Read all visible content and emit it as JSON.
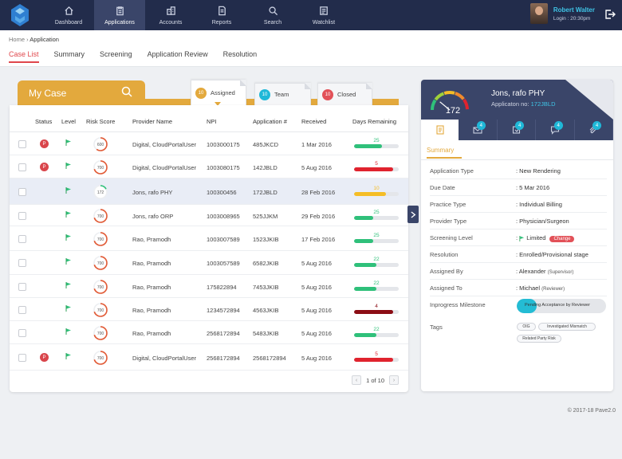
{
  "nav": {
    "items": [
      {
        "label": "Dashboard",
        "icon": "home-icon"
      },
      {
        "label": "Applications",
        "icon": "clipboard-icon"
      },
      {
        "label": "Accounts",
        "icon": "building-icon"
      },
      {
        "label": "Reports",
        "icon": "report-icon"
      },
      {
        "label": "Search",
        "icon": "search-icon"
      },
      {
        "label": "Watchlist",
        "icon": "watchlist-icon"
      }
    ],
    "active": "Applications"
  },
  "user": {
    "name": "Robert Walter",
    "login": "Login : 20:30pm"
  },
  "breadcrumb": {
    "home": "Home",
    "sep": "›",
    "current": "Application"
  },
  "tabs": [
    "Case List",
    "Summary",
    "Screening",
    "Application Review",
    "Resolution"
  ],
  "mycase": {
    "title": "My Case",
    "filters": [
      {
        "count": "10",
        "label": "Assigned",
        "color": "#e3a93d"
      },
      {
        "count": "10",
        "label": "Team",
        "color": "#1fb8d8"
      },
      {
        "count": "10",
        "label": "Closed",
        "color": "#e25158"
      }
    ]
  },
  "table": {
    "headers": [
      "Status",
      "Level",
      "Risk Score",
      "Provider Name",
      "NPI",
      "Application #",
      "Received",
      "Days Remaining"
    ],
    "rows": [
      {
        "status": "P",
        "risk": "600",
        "risk_pct": 0.6,
        "provider": "Digital, CloudPortalUser",
        "npi": "1003000175",
        "app": "485JKCD",
        "received": "1 Mar 2016",
        "days": "25",
        "days_pct": 0.62,
        "color": "#2fc07a"
      },
      {
        "status": "P",
        "risk": "700",
        "risk_pct": 0.7,
        "provider": "Digital, CloudPortalUser",
        "npi": "1003080175",
        "app": "142JBLD",
        "received": "5 Aug 2016",
        "days": "5",
        "days_pct": 0.88,
        "color": "#e0232e"
      },
      {
        "status": "",
        "risk": "172",
        "risk_pct": 0.17,
        "provider": "Jons, rafo PHY",
        "npi": "100300456",
        "app": "172JBLD",
        "received": "28 Feb 2016",
        "days": "10",
        "days_pct": 0.72,
        "color": "#f5bd26",
        "selected": true
      },
      {
        "status": "",
        "risk": "700",
        "risk_pct": 0.7,
        "provider": "Jons, rafo ORP",
        "npi": "1003008965",
        "app": "525JJKM",
        "received": "29 Feb 2016",
        "days": "25",
        "days_pct": 0.42,
        "color": "#2fc07a"
      },
      {
        "status": "",
        "risk": "700",
        "risk_pct": 0.7,
        "provider": "Rao, Pramodh",
        "npi": "1003007589",
        "app": "1523JKIB",
        "received": "17 Feb 2016",
        "days": "25",
        "days_pct": 0.42,
        "color": "#2fc07a"
      },
      {
        "status": "",
        "risk": "700",
        "risk_pct": 0.7,
        "provider": "Rao, Pramodh",
        "npi": "1003057589",
        "app": "6582JKIB",
        "received": "5 Aug 2016",
        "days": "22",
        "days_pct": 0.5,
        "color": "#2fc07a"
      },
      {
        "status": "",
        "risk": "700",
        "risk_pct": 0.7,
        "provider": "Rao, Pramodh",
        "npi": "175822894",
        "app": "7453JKIB",
        "received": "5 Aug 2016",
        "days": "22",
        "days_pct": 0.5,
        "color": "#2fc07a"
      },
      {
        "status": "",
        "risk": "700",
        "risk_pct": 0.7,
        "provider": "Rao, Pramodh",
        "npi": "1234572894",
        "app": "4563JKIB",
        "received": "5 Aug 2016",
        "days": "4",
        "days_pct": 0.88,
        "color": "#8b0d14"
      },
      {
        "status": "",
        "risk": "700",
        "risk_pct": 0.7,
        "provider": "Rao, Pramodh",
        "npi": "2568172894",
        "app": "5483JKIB",
        "received": "5 Aug 2016",
        "days": "22",
        "days_pct": 0.5,
        "color": "#2fc07a"
      },
      {
        "status": "P",
        "risk": "700",
        "risk_pct": 0.7,
        "provider": "Digital, CloudPortalUser",
        "npi": "2568172894",
        "app": "2568172894",
        "received": "5 Aug 2016",
        "days": "5",
        "days_pct": 0.88,
        "color": "#e0232e"
      }
    ]
  },
  "pager": {
    "label": "1 of 10",
    "prev": "‹",
    "next": "›"
  },
  "detail": {
    "name": "Jons, rafo PHY",
    "app_label": "Applicaton no:",
    "app_no": "172JBLD",
    "score": "172",
    "score_pct": 0.22,
    "icon_badges": [
      "4",
      "4",
      "4",
      "4"
    ],
    "summary_tab": "Summary",
    "fields": [
      {
        "k": "Application Type",
        "v": "New Rendering"
      },
      {
        "k": "Due Date",
        "v": "5 Mar 2016"
      },
      {
        "k": "Practice Type",
        "v": "Individual Billing"
      },
      {
        "k": "Provider Type",
        "v": "Physician/Surgeon"
      },
      {
        "k": "Screening Level",
        "v": "Limited",
        "btn": "Change"
      },
      {
        "k": "Resolution",
        "v": "Enrolled/Provisional stage"
      },
      {
        "k": "Assigned By",
        "v": "Alexander",
        "note": "(Supervisor)"
      },
      {
        "k": "Assigned To",
        "v": "Michael",
        "note": "(Reviewer)"
      }
    ],
    "milestone_label": "Inprogress Milestone",
    "milestone_text": "Pending Acceptance by Reviewer",
    "milestone_pct": 0.22,
    "tags_label": "Tags",
    "tags": [
      "OIG",
      "Investigated Mismatch",
      "Related Party Risk"
    ]
  },
  "footer": "© 2017-18  Pave2.0"
}
